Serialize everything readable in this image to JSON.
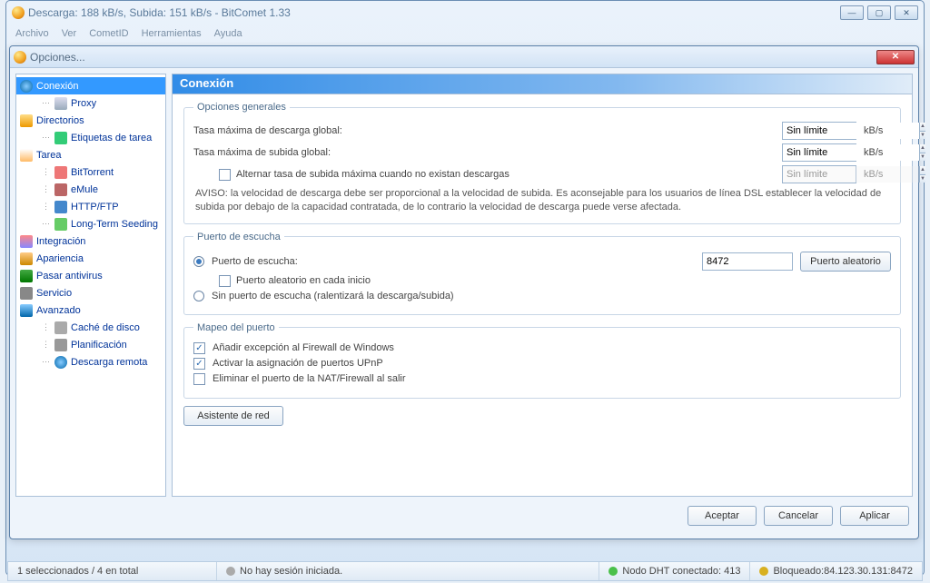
{
  "main_window": {
    "title": "Descarga: 188 kB/s, Subida: 151 kB/s - BitComet 1.33",
    "menu": [
      "Archivo",
      "Ver",
      "CometID",
      "Herramientas",
      "Ayuda"
    ]
  },
  "dialog": {
    "title": "Opciones...",
    "tree": [
      {
        "label": "Conexión",
        "level": 0,
        "selected": true,
        "icon": "globe"
      },
      {
        "label": "Proxy",
        "level": 1,
        "icon": "proxy"
      },
      {
        "label": "Directorios",
        "level": 0,
        "icon": "folder"
      },
      {
        "label": "Etiquetas de tarea",
        "level": 1,
        "icon": "tag"
      },
      {
        "label": "Tarea",
        "level": 0,
        "icon": "task"
      },
      {
        "label": "BitTorrent",
        "level": 1,
        "icon": "bt"
      },
      {
        "label": "eMule",
        "level": 1,
        "icon": "emule"
      },
      {
        "label": "HTTP/FTP",
        "level": 1,
        "icon": "http"
      },
      {
        "label": "Long-Term Seeding",
        "level": 1,
        "icon": "lts"
      },
      {
        "label": "Integración",
        "level": 0,
        "icon": "integration"
      },
      {
        "label": "Apariencia",
        "level": 0,
        "icon": "appearance"
      },
      {
        "label": "Pasar antivirus",
        "level": 0,
        "icon": "av"
      },
      {
        "label": "Servicio",
        "level": 0,
        "icon": "service"
      },
      {
        "label": "Avanzado",
        "level": 0,
        "icon": "advanced"
      },
      {
        "label": "Caché de disco",
        "level": 1,
        "icon": "cache"
      },
      {
        "label": "Planificación",
        "level": 1,
        "icon": "sched"
      },
      {
        "label": "Descarga remota",
        "level": 1,
        "icon": "remote"
      }
    ],
    "panel": {
      "title": "Conexión",
      "general": {
        "legend": "Opciones generales",
        "dl_label": "Tasa máxima de descarga global:",
        "dl_value": "Sin límite",
        "ul_label": "Tasa máxima de subida global:",
        "ul_value": "Sin límite",
        "alt_check_label": "Alternar tasa de subida máxima cuando no existan descargas",
        "alt_value": "Sin límite",
        "unit": "kB/s",
        "note": "AVISO: la velocidad de descarga debe ser proporcional a la velocidad de subida. Es aconsejable para los usuarios de línea DSL establecer la velocidad de subida por debajo de la capacidad contratada, de lo contrario la velocidad de descarga puede verse afectada."
      },
      "listen": {
        "legend": "Puerto de escucha",
        "opt1": "Puerto de escucha:",
        "port_value": "8472",
        "random_btn": "Puerto aleatorio",
        "random_each": "Puerto aleatorio en cada inicio",
        "opt2": "Sin puerto de escucha (ralentizará la descarga/subida)"
      },
      "mapping": {
        "legend": "Mapeo del puerto",
        "fw": "Añadir excepción al Firewall de Windows",
        "upnp": "Activar la asignación de puertos UPnP",
        "nat": "Eliminar el puerto de la NAT/Firewall al salir"
      },
      "wizard_btn": "Asistente de red"
    },
    "buttons": {
      "ok": "Aceptar",
      "cancel": "Cancelar",
      "apply": "Aplicar"
    }
  },
  "statusbar": {
    "selection": "1 seleccionados / 4 en total",
    "session": "No hay sesión iniciada.",
    "dht": "Nodo DHT conectado: 413",
    "blocked": "Bloqueado:84.123.30.131:8472"
  }
}
